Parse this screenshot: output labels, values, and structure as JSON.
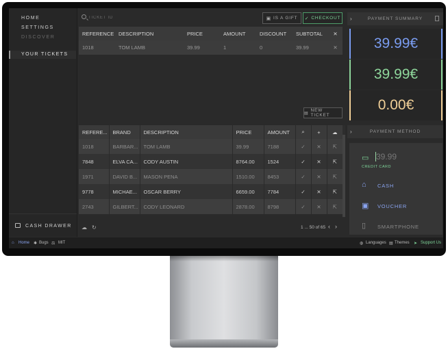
{
  "sidebar": {
    "items": [
      {
        "label": "HOME"
      },
      {
        "label": "SETTINGS"
      },
      {
        "label": "DISCOVER"
      }
    ],
    "active_label": "YOUR TICKETS",
    "cash_drawer_label": "CASH DRAWER"
  },
  "toolbar": {
    "search_placeholder": "TICKET ID",
    "gift_label": "IS A GIFT",
    "checkout_label": "CHECKOUT",
    "new_ticket_label": "NEW TICKET"
  },
  "ticket_table": {
    "columns": [
      "REFERENCE",
      "DESCRIPTION",
      "PRICE",
      "AMOUNT",
      "DISCOUNT",
      "SUBTOTAL"
    ],
    "rows": [
      {
        "reference": "1018",
        "description": "TOM LAMB",
        "price": "39.99",
        "amount": "1",
        "discount": "0",
        "subtotal": "39.99"
      }
    ]
  },
  "product_table": {
    "columns": [
      "REFERE...",
      "BRAND",
      "DESCRIPTION",
      "PRICE",
      "AMOUNT"
    ],
    "rows": [
      {
        "reference": "1018",
        "brand": "BARBAR...",
        "description": "TOM LAMB",
        "price": "39.99",
        "amount": "7188"
      },
      {
        "reference": "7848",
        "brand": "ELVA CA...",
        "description": "CODY AUSTIN",
        "price": "8764.00",
        "amount": "1524"
      },
      {
        "reference": "1971",
        "brand": "DAVID B...",
        "description": "MASON PENA",
        "price": "1510.00",
        "amount": "8453"
      },
      {
        "reference": "9778",
        "brand": "MICHAE...",
        "description": "OSCAR BERRY",
        "price": "6659.00",
        "amount": "7784"
      },
      {
        "reference": "2743",
        "brand": "GILBERT...",
        "description": "CODY LEONARD",
        "price": "2878.00",
        "amount": "8798"
      }
    ],
    "pagination": "1 ... 50 of 65"
  },
  "payment_summary": {
    "title": "PAYMENT SUMMARY",
    "total": "39.99€",
    "paid": "39.99€",
    "change": "0.00€",
    "colors": {
      "total": "#7a9cf0",
      "paid": "#8ed69b",
      "change": "#f0cf97"
    }
  },
  "payment_method": {
    "title": "PAYMENT METHOD",
    "credit_card_value": "39.99",
    "credit_card_label": "CREDIT CARD",
    "cash_label": "CASH",
    "voucher_label": "VOUCHER",
    "smartphone_label": "SMARTPHONE",
    "colors": {
      "credit": "#7fd69a",
      "cash": "#8aa4f0",
      "voucher": "#8aa4f0",
      "smartphone": "#8a8a8a"
    }
  },
  "status_bar": {
    "home": "Home",
    "bugs": "Bugs",
    "mit": "MIT",
    "languages": "Languages",
    "themes": "Themes",
    "support": "Support Us"
  }
}
